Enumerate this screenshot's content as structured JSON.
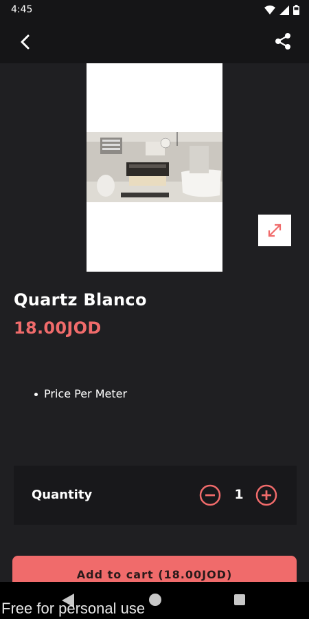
{
  "status": {
    "time": "4:45"
  },
  "product": {
    "title": "Quartz Blanco",
    "price": "18.00JOD",
    "bullets": [
      "Price Per Meter"
    ]
  },
  "quantity": {
    "label": "Quantity",
    "value": "1"
  },
  "cart": {
    "label": "Add to cart (18.00JOD)"
  },
  "watermark": "Free for personal use",
  "colors": {
    "accent": "#f06b6b",
    "background": "#1f1f22",
    "appbar": "#151517"
  },
  "icons": {
    "back": "arrow-back-icon",
    "share": "share-icon",
    "expand": "expand-arrows-icon",
    "minus": "minus-circle-icon",
    "plus": "plus-circle-icon"
  }
}
